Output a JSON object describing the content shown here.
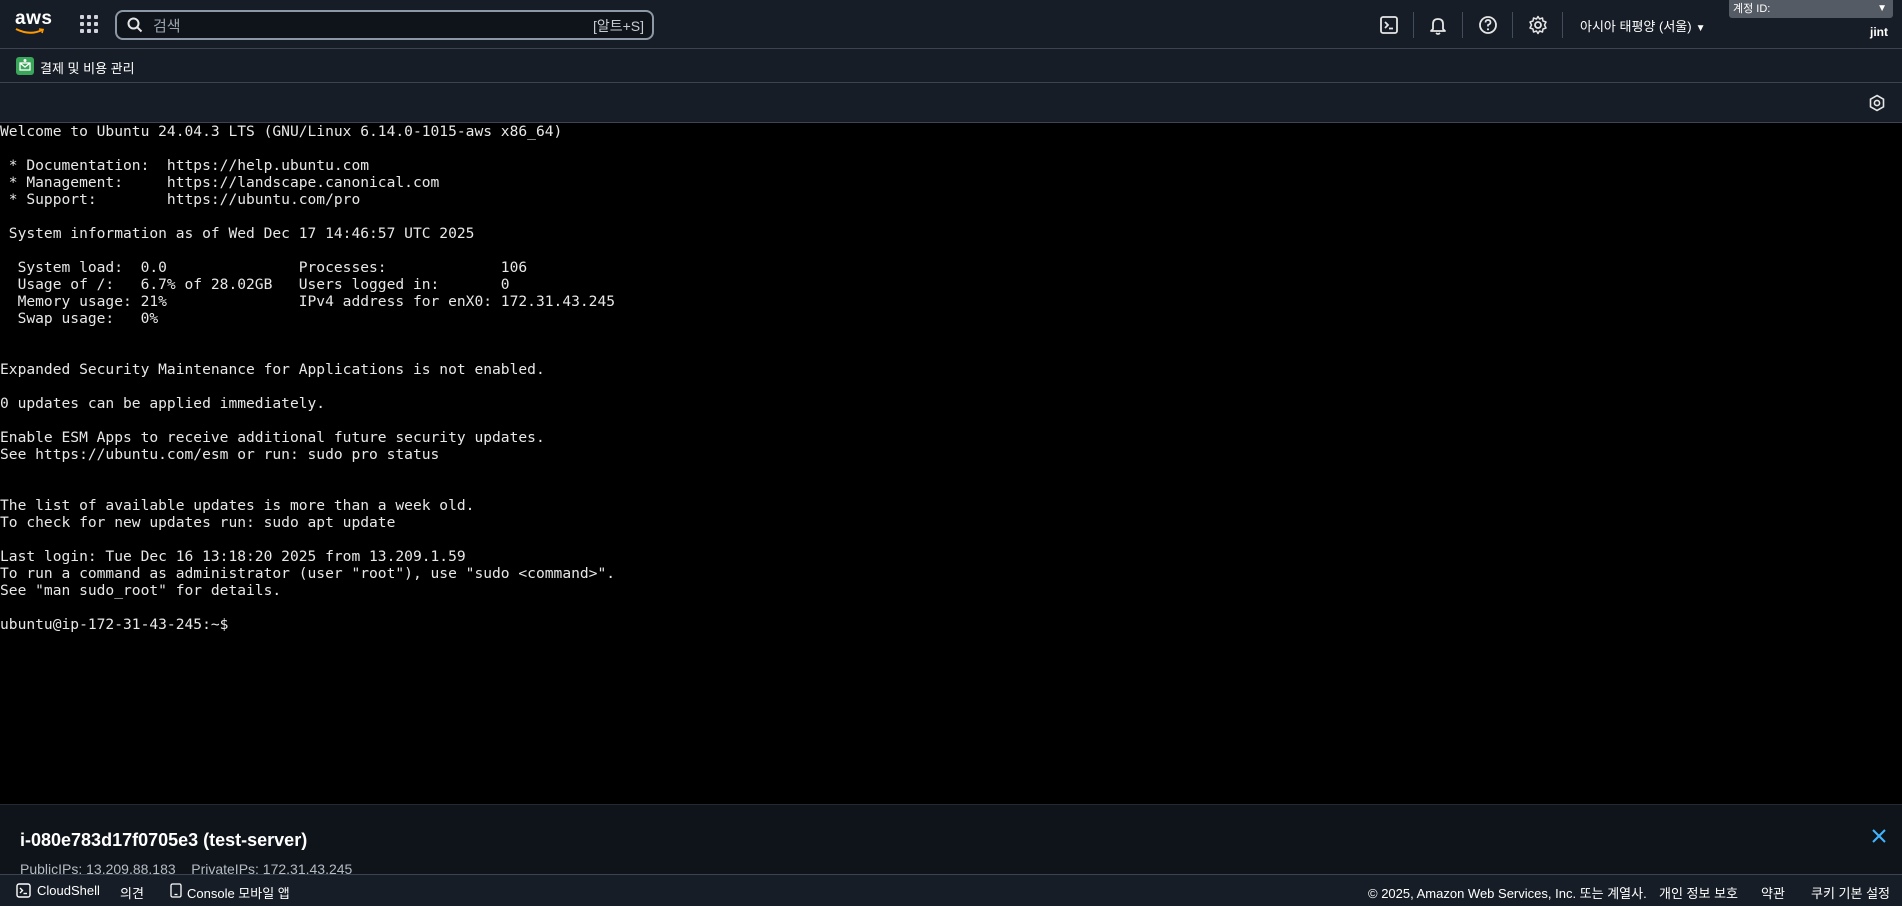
{
  "topnav": {
    "logo_text": "aws",
    "search": {
      "placeholder": "검색",
      "shortcut": "[알트+S]"
    },
    "icons": [
      "cloudshell-icon",
      "bell-icon",
      "help-icon",
      "gear-icon"
    ],
    "region": "아시아 태평양 (서울)",
    "account_label": "계정 ID:",
    "username": "jint"
  },
  "servicebar": {
    "label": "결제 및 비용 관리"
  },
  "terminal": {
    "lines": [
      "Welcome to Ubuntu 24.04.3 LTS (GNU/Linux 6.14.0-1015-aws x86_64)",
      "",
      " * Documentation:  https://help.ubuntu.com",
      " * Management:     https://landscape.canonical.com",
      " * Support:        https://ubuntu.com/pro",
      "",
      " System information as of Wed Dec 17 14:46:57 UTC 2025",
      "",
      "  System load:  0.0               Processes:             106",
      "  Usage of /:   6.7% of 28.02GB   Users logged in:       0",
      "  Memory usage: 21%               IPv4 address for enX0: 172.31.43.245",
      "  Swap usage:   0%",
      "",
      "",
      "Expanded Security Maintenance for Applications is not enabled.",
      "",
      "0 updates can be applied immediately.",
      "",
      "Enable ESM Apps to receive additional future security updates.",
      "See https://ubuntu.com/esm or run: sudo pro status",
      "",
      "",
      "The list of available updates is more than a week old.",
      "To check for new updates run: sudo apt update",
      "",
      "Last login: Tue Dec 16 13:18:20 2025 from 13.209.1.59",
      "To run a command as administrator (user \"root\"), use \"sudo <command>\".",
      "See \"man sudo_root\" for details.",
      "",
      "ubuntu@ip-172-31-43-245:~$ "
    ]
  },
  "instance": {
    "title": "i-080e783d17f0705e3 (test-server)",
    "ips": "PublicIPs: 13.209.88.183    PrivateIPs: 172.31.43.245"
  },
  "footer": {
    "cloudshell": "CloudShell",
    "feedback": "의견",
    "mobile_app": "Console 모바일 앱",
    "copyright": "© 2025, Amazon Web Services, Inc. 또는 계열사.",
    "privacy": "개인 정보 보호",
    "terms": "약관",
    "cookies": "쿠키 기본 설정"
  },
  "colors": {
    "nav_bg": "#161d26",
    "terminal_bg": "#000000",
    "terminal_fg": "#e8e8e8",
    "instance_panel_bg": "#0f141a",
    "close_accent": "#42b4ff",
    "service_icon": "#3aa65a"
  }
}
